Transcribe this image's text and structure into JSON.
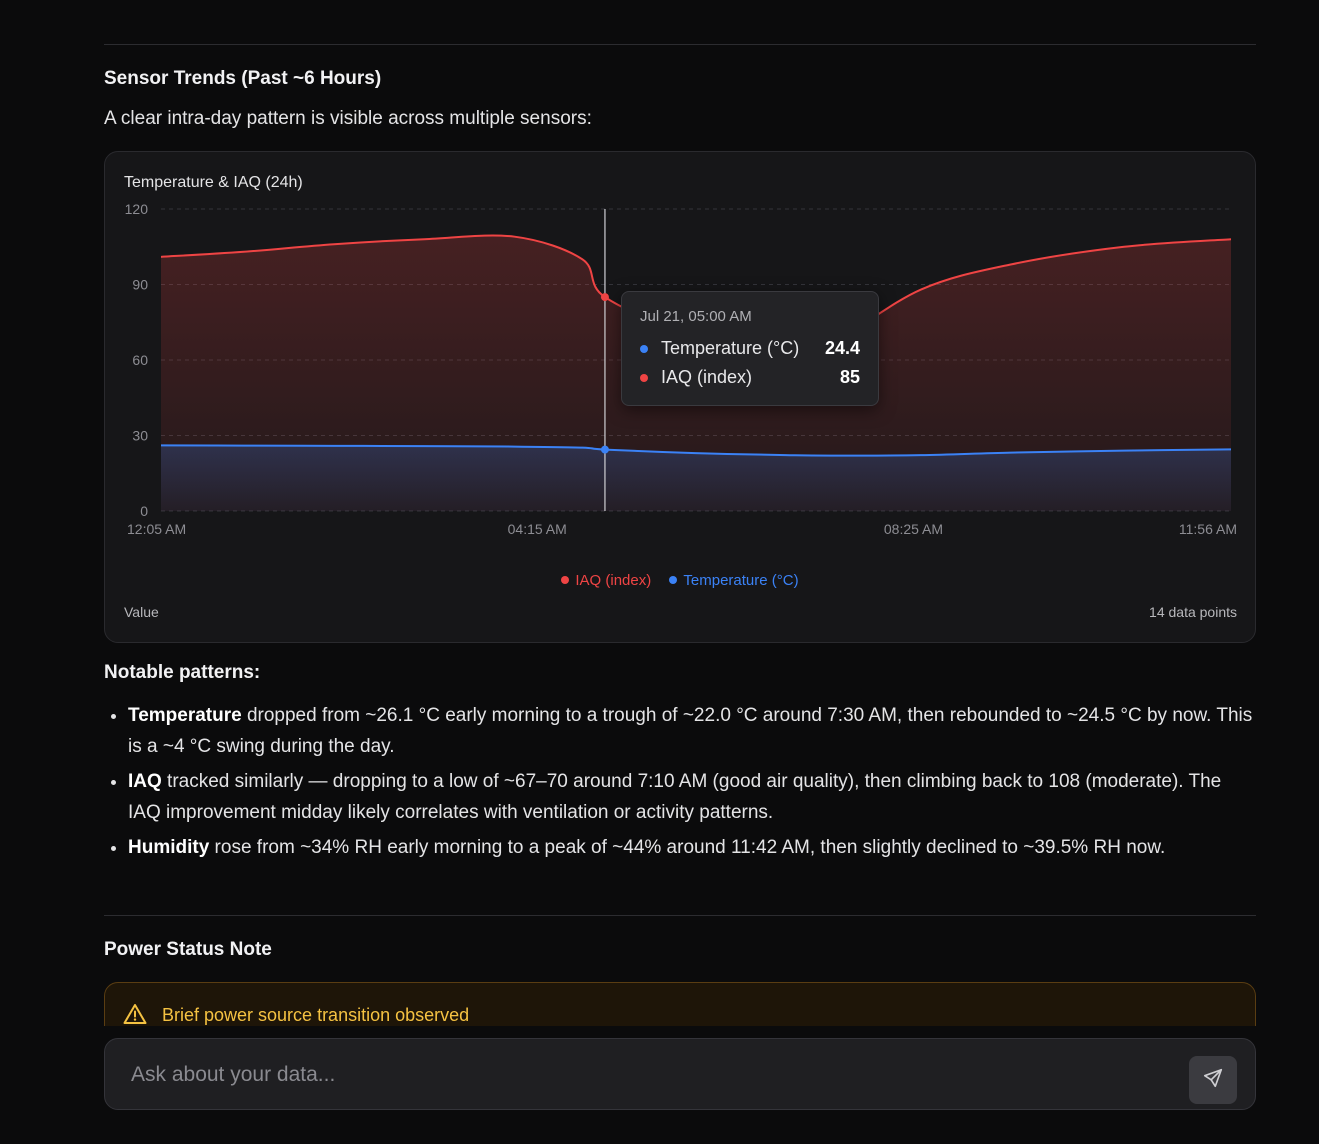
{
  "sections": {
    "trends_title": "Sensor Trends (Past ~6 Hours)",
    "trends_intro": "A clear intra-day pattern is visible across multiple sensors:",
    "patterns_title": "Notable patterns:",
    "power_title": "Power Status Note"
  },
  "chart_card": {
    "title": "Temperature & IAQ (24h)",
    "footer_left": "Value",
    "footer_right": "14 data points"
  },
  "chart_data": {
    "type": "area",
    "title": "Temperature & IAQ (24h)",
    "ylabel": "Value",
    "ylim": [
      0,
      120
    ],
    "yticks": [
      0,
      30,
      60,
      90,
      120
    ],
    "x_range": [
      "12:05 AM",
      "11:56 AM"
    ],
    "xtick_labels": [
      "12:05 AM",
      "04:15 AM",
      "08:25 AM",
      "11:56 AM"
    ],
    "grid": true,
    "legend_position": "bottom-center",
    "x": [
      "00:05",
      "01:00",
      "02:00",
      "03:00",
      "04:00",
      "04:45",
      "05:00",
      "06:00",
      "07:00",
      "07:30",
      "08:30",
      "09:30",
      "10:45",
      "11:56"
    ],
    "series": [
      {
        "name": "IAQ (index)",
        "color": "#ef4444",
        "values": [
          101,
          103,
          106,
          108,
          109,
          100,
          85,
          70,
          68,
          67,
          88,
          98,
          105,
          108
        ]
      },
      {
        "name": "Temperature (°C)",
        "color": "#3b82f6",
        "values": [
          26.1,
          26.0,
          25.9,
          25.8,
          25.6,
          25.2,
          24.4,
          23.0,
          22.2,
          22.0,
          22.2,
          23.2,
          24.0,
          24.5
        ]
      }
    ],
    "tooltip": {
      "date": "Jul 21, 05:00 AM",
      "rows": [
        {
          "name": "Temperature (°C)",
          "value": "24.4",
          "color": "#3b82f6"
        },
        {
          "name": "IAQ (index)",
          "value": "85",
          "color": "#ef4444"
        }
      ]
    }
  },
  "patterns": [
    {
      "label": "Temperature",
      "text": " dropped from ~26.1 °C early morning to a trough of ~22.0 °C around 7:30 AM, then rebounded to ~24.5 °C by now. This is a ~4 °C swing during the day."
    },
    {
      "label": "IAQ",
      "text": " tracked similarly — dropping to a low of ~67–70 around 7:10 AM (good air quality), then climbing back to 108 (moderate). The IAQ improvement midday likely correlates with ventilation or activity patterns."
    },
    {
      "label": "Humidity",
      "text": " rose from ~34% RH early morning to a peak of ~44% around 11:42 AM, then slightly declined to ~39.5% RH now."
    }
  ],
  "alert": {
    "icon": "warning-icon",
    "text": "Brief power source transition observed",
    "color": "#f5c242"
  },
  "input": {
    "placeholder": "Ask about your data...",
    "send_icon": "send-icon"
  }
}
